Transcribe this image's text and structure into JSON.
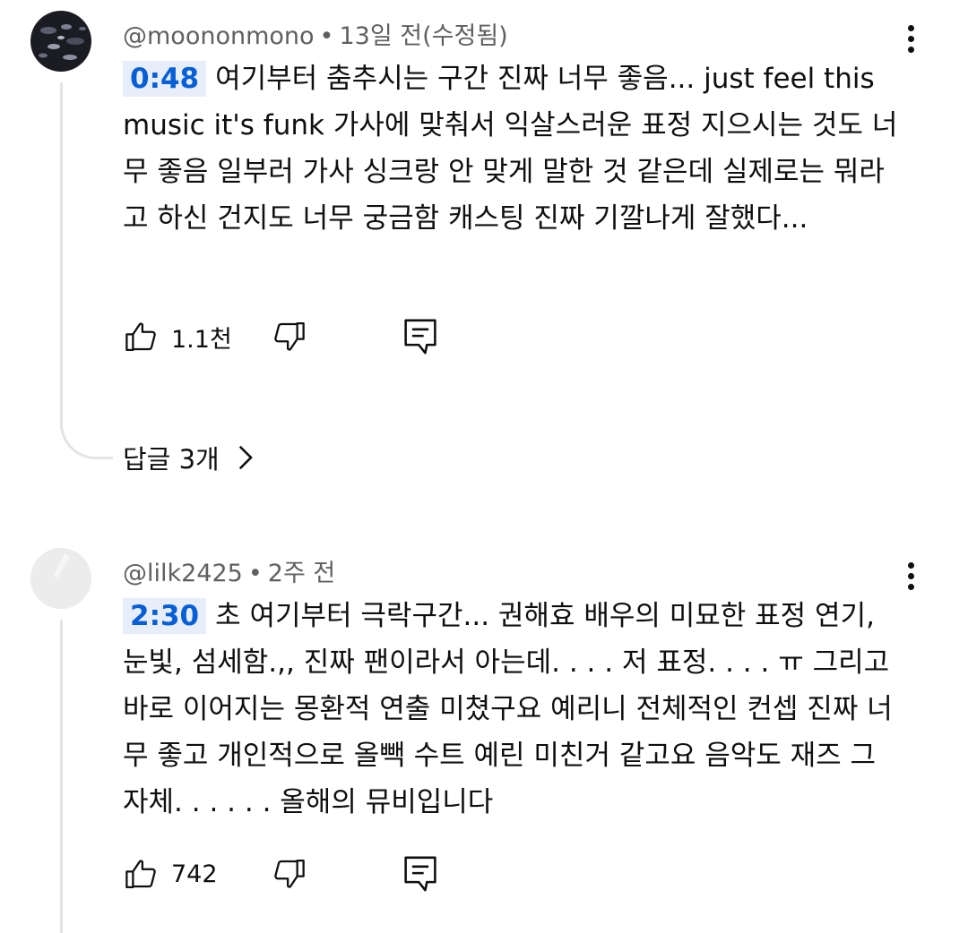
{
  "comments": [
    {
      "author": "@moononmono",
      "separator": "•",
      "time": "13일 전(수정됨)",
      "timestamp": "0:48",
      "text": "여기부터 춤추시는 구간 진짜 너무 좋음... just feel this music it's funk 가사에 맞춰서 익살스러운 표정 지으시는 것도 너무 좋음 일부러 가사 싱크랑 안 맞게 말한 것 같은데 실제로는 뭐라고 하신 건지도 너무 궁금함 캐스팅 진짜 기깔나게 잘했다...",
      "likes": "1.1천",
      "replies_label": "답글 3개",
      "icons": {
        "like": "thumbs-up-icon",
        "dislike": "thumbs-down-icon",
        "reply": "comment-icon",
        "more": "more-vert-icon",
        "expand": "chevron-right-icon"
      }
    },
    {
      "author": "@lilk2425",
      "separator": "•",
      "time": "2주 전",
      "timestamp": "2:30",
      "text": "초 여기부터 극락구간... 권해효 배우의 미묘한 표정 연기, 눈빛, 섬세함.,, 진짜 팬이라서 아는데. . . . 저 표정. . . . ㅠ 그리고 바로 이어지는 몽환적 연출 미쳤구요 예리니 전체적인 컨셉 진짜 너무 좋고 개인적으로 올빽 수트 예린 미친거 같고요 음악도 재즈 그 자체. . . . . . 올해의 뮤비입니다",
      "likes": "742",
      "icons": {
        "like": "thumbs-up-icon",
        "dislike": "thumbs-down-icon",
        "reply": "comment-icon",
        "more": "more-vert-icon"
      }
    }
  ],
  "colors": {
    "timestamp_text": "#065fd4",
    "timestamp_bg": "#e7eef9",
    "meta_text": "#606060",
    "thread_line": "#e4e4e4"
  }
}
